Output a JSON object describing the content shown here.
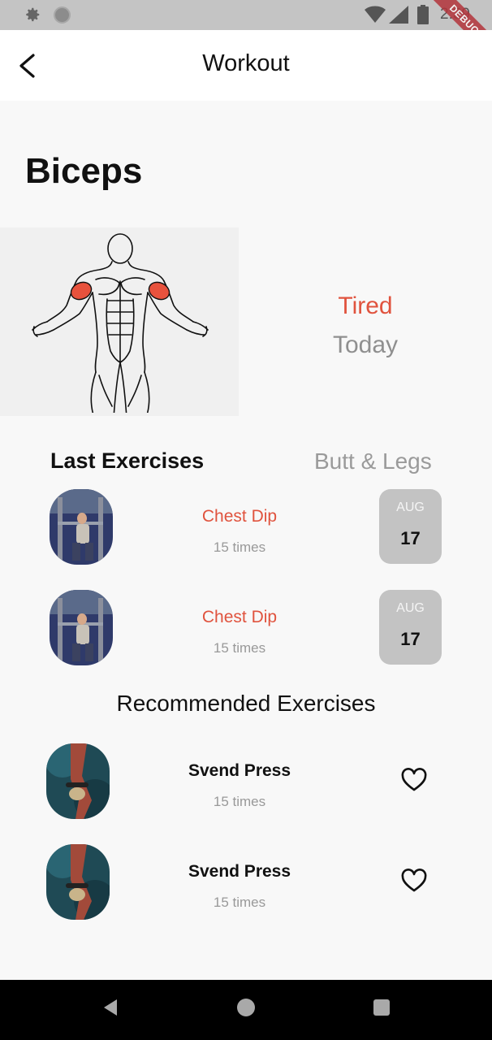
{
  "status_bar": {
    "time": "2:39",
    "debug_label": "DEBUG",
    "icons": [
      "gear-icon",
      "circle-indicator-icon",
      "wifi-icon",
      "signal-icon",
      "battery-icon"
    ]
  },
  "app_bar": {
    "title": "Workout",
    "back_icon": "chevron-left-icon"
  },
  "page": {
    "title": "Biceps",
    "muscle_status": "Tired",
    "muscle_status_when": "Today"
  },
  "sections": {
    "last_exercises": "Last Exercises",
    "butt_legs": "Butt & Legs",
    "recommended": "Recommended Exercises"
  },
  "last_exercises": [
    {
      "name": "Chest Dip",
      "count": "15 times",
      "month": "AUG",
      "day": "17"
    },
    {
      "name": "Chest Dip",
      "count": "15 times",
      "month": "AUG",
      "day": "17"
    }
  ],
  "recommended_exercises": [
    {
      "name": "Svend Press",
      "count": "15 times",
      "icon": "heart-outline-icon"
    },
    {
      "name": "Svend Press",
      "count": "15 times",
      "icon": "heart-outline-icon"
    }
  ],
  "colors": {
    "accent_red": "#e0533e",
    "muted_gray": "#9a9a9a",
    "badge_gray": "#c3c3c3",
    "muscle_highlight": "#e8523d"
  },
  "nav_bar": {
    "icons": [
      "nav-back-icon",
      "nav-home-icon",
      "nav-recent-icon"
    ]
  }
}
